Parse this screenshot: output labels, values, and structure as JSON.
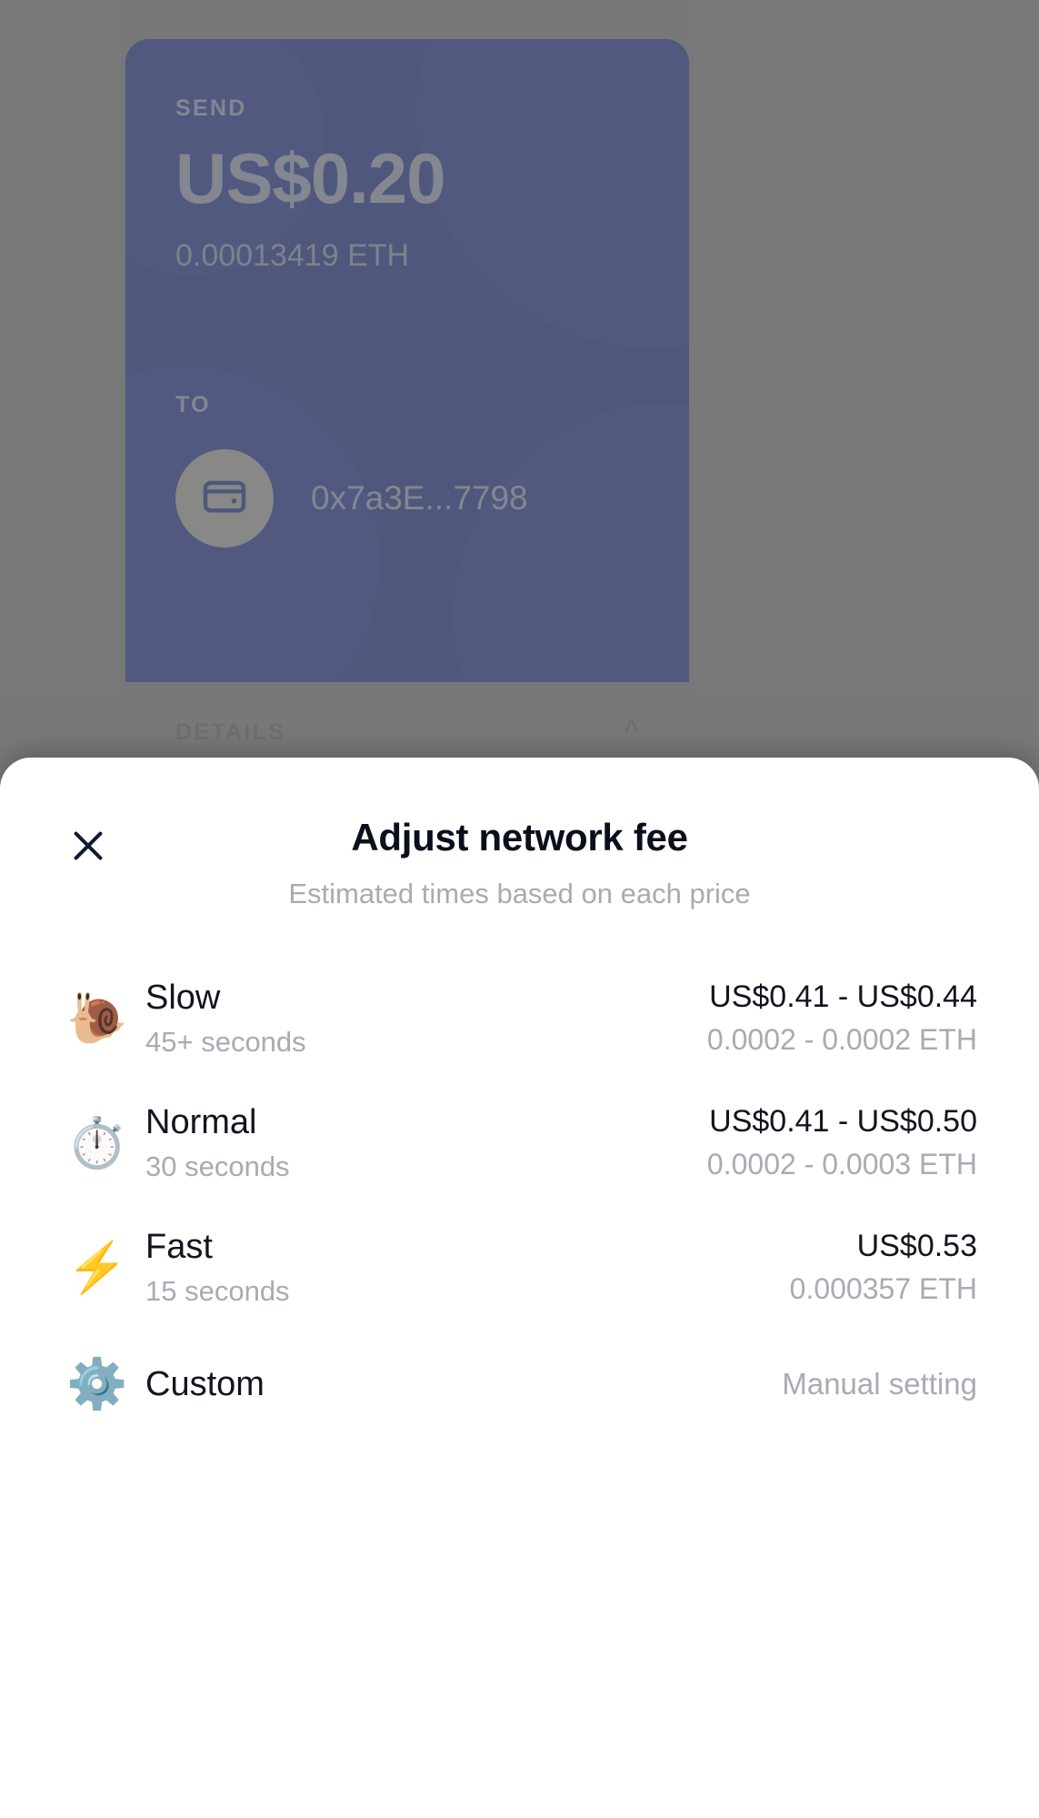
{
  "background": {
    "send_label": "SEND",
    "amount_fiat": "US$0.20",
    "amount_crypto": "0.00013419 ETH",
    "to_label": "TO",
    "recipient_address": "0x7a3E...7798",
    "recipient_icon": "wallet-icon",
    "details_label": "DETAILS",
    "details_chevron": "chevron-up-icon",
    "card_color": "#1e3293"
  },
  "sheet": {
    "close_icon": "close-icon",
    "title": "Adjust network fee",
    "subtitle": "Estimated times based on each price",
    "options": [
      {
        "icon": "snail-icon",
        "emoji": "🐌",
        "name": "Slow",
        "time": "45+ seconds",
        "price_fiat": "US$0.41 - US$0.44",
        "price_eth": "0.0002 - 0.0002 ETH"
      },
      {
        "icon": "stopwatch-icon",
        "emoji": "⏱️",
        "name": "Normal",
        "time": "30 seconds",
        "price_fiat": "US$0.41 - US$0.50",
        "price_eth": "0.0002 - 0.0003 ETH"
      },
      {
        "icon": "lightning-bolt-icon",
        "emoji": "⚡",
        "name": "Fast",
        "time": "15 seconds",
        "price_fiat": "US$0.53",
        "price_eth": "0.000357 ETH"
      }
    ],
    "custom": {
      "icon": "gear-icon",
      "emoji": "⚙️",
      "name": "Custom",
      "value": "Manual setting"
    }
  }
}
